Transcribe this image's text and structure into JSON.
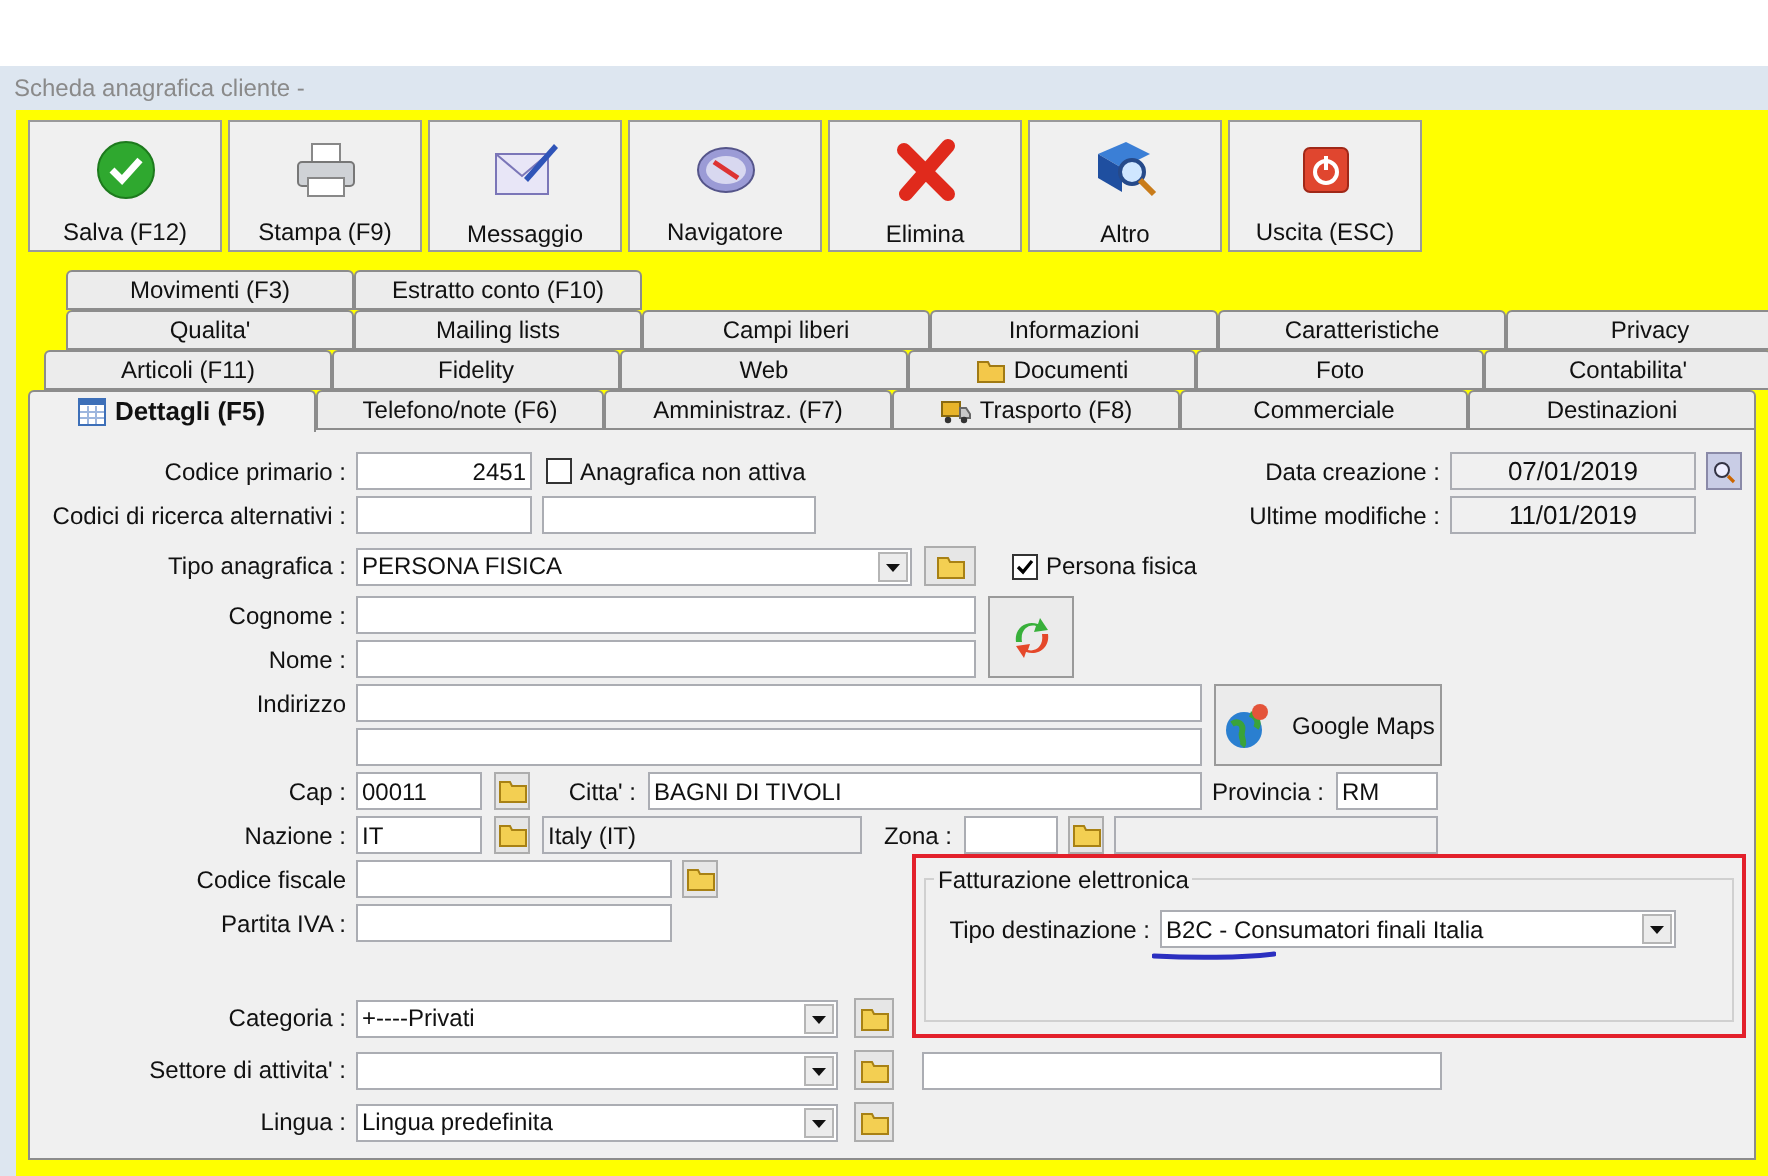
{
  "window": {
    "title": "Scheda anagrafica cliente -"
  },
  "toolbar": [
    {
      "label": "Salva (F12)",
      "kind": "save"
    },
    {
      "label": "Stampa (F9)",
      "kind": "print"
    },
    {
      "label": "Messaggio",
      "kind": "message"
    },
    {
      "label": "Navigatore",
      "kind": "navigator"
    },
    {
      "label": "Elimina",
      "kind": "delete"
    },
    {
      "label": "Altro",
      "kind": "more"
    },
    {
      "label": "Uscita (ESC)",
      "kind": "exit"
    }
  ],
  "tab_rows": [
    [
      {
        "label": "Movimenti (F3)",
        "selected": false
      },
      {
        "label": "Estratto conto (F10)",
        "selected": false
      }
    ],
    [
      {
        "label": "Qualita'",
        "selected": false
      },
      {
        "label": "Mailing lists",
        "selected": false
      },
      {
        "label": "Campi liberi",
        "selected": false
      },
      {
        "label": "Informazioni",
        "selected": false
      },
      {
        "label": "Caratteristiche",
        "selected": false
      },
      {
        "label": "Privacy",
        "selected": false
      }
    ],
    [
      {
        "label": "Articoli (F11)",
        "selected": false
      },
      {
        "label": "Fidelity",
        "selected": false
      },
      {
        "label": "Web",
        "selected": false
      },
      {
        "label": "Documenti",
        "selected": false,
        "kind": "folder"
      },
      {
        "label": "Foto",
        "selected": false
      },
      {
        "label": "Contabilita'",
        "selected": false
      }
    ],
    [
      {
        "label": "Dettagli (F5)",
        "selected": true,
        "kind": "calendar"
      },
      {
        "label": "Telefono/note (F6)",
        "selected": false
      },
      {
        "label": "Amministraz. (F7)",
        "selected": false
      },
      {
        "label": "Trasporto (F8)",
        "selected": false,
        "kind": "truck"
      },
      {
        "label": "Commerciale",
        "selected": false
      },
      {
        "label": "Destinazioni",
        "selected": false
      }
    ]
  ],
  "form": {
    "codice_primario": {
      "label": "Codice primario :",
      "value": "2451"
    },
    "non_attiva": {
      "label": "Anagrafica non attiva",
      "checked": false
    },
    "codici_alternativi": {
      "label": "Codici di ricerca alternativi :"
    },
    "data_creazione": {
      "label": "Data creazione :",
      "value": "07/01/2019"
    },
    "ultime_modifiche": {
      "label": "Ultime modifiche :",
      "value": "11/01/2019"
    },
    "tipo_anagrafica": {
      "label": "Tipo anagrafica :",
      "value": "PERSONA FISICA"
    },
    "persona_fisica": {
      "label": "Persona fisica",
      "checked": true
    },
    "cognome": {
      "label": "Cognome :"
    },
    "nome": {
      "label": "Nome :"
    },
    "indirizzo": {
      "label": "Indirizzo"
    },
    "google_maps": {
      "label": "Google Maps"
    },
    "cap": {
      "label": "Cap :",
      "value": "00011"
    },
    "citta": {
      "label": "Citta' :",
      "value": "BAGNI DI TIVOLI"
    },
    "provincia": {
      "label": "Provincia :",
      "value": "RM"
    },
    "nazione": {
      "label": "Nazione :",
      "value": "IT",
      "description": "Italy (IT)"
    },
    "zona": {
      "label": "Zona :"
    },
    "codice_fiscale": {
      "label": "Codice fiscale"
    },
    "partita_iva": {
      "label": "Partita IVA :"
    },
    "fatturazione": {
      "title": "Fatturazione elettronica",
      "label": "Tipo destinazione :",
      "value": "B2C - Consumatori finali Italia"
    },
    "categoria": {
      "label": "Categoria :",
      "value": "+----Privati"
    },
    "settore": {
      "label": "Settore di attivita' :"
    },
    "lingua": {
      "label": "Lingua :",
      "value": "Lingua predefinita"
    }
  }
}
